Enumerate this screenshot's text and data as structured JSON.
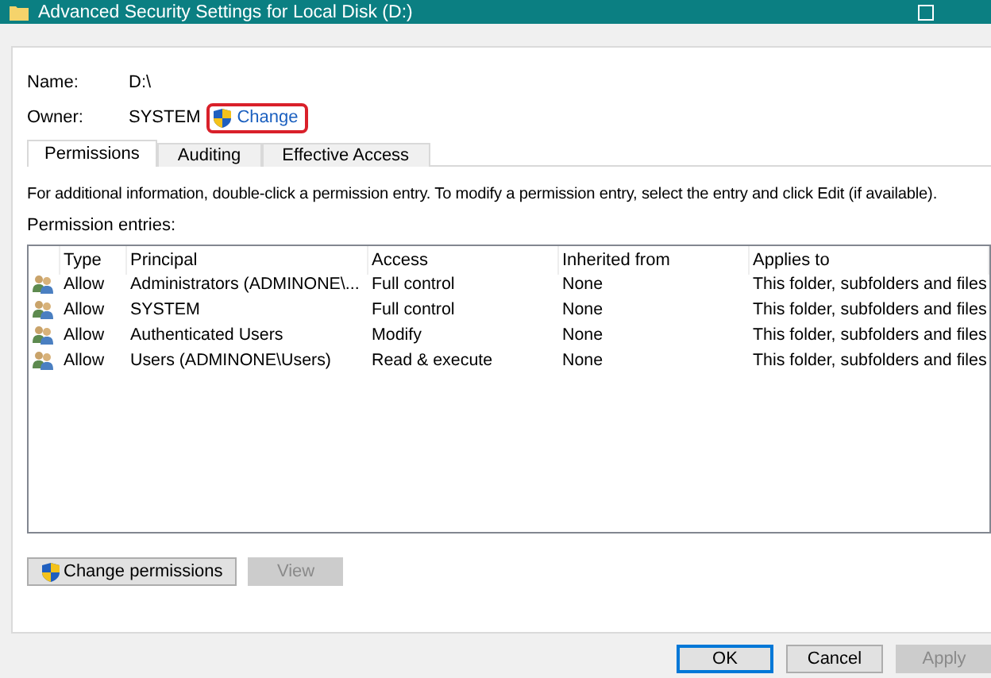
{
  "window": {
    "title": "Advanced Security Settings for Local Disk (D:)"
  },
  "name": {
    "label": "Name:",
    "value": "D:\\"
  },
  "owner": {
    "label": "Owner:",
    "value": "SYSTEM",
    "link": "Change"
  },
  "tabs": [
    {
      "label": "Permissions",
      "selected": true
    },
    {
      "label": "Auditing",
      "selected": false
    },
    {
      "label": "Effective Access",
      "selected": false
    }
  ],
  "info": "For additional information, double-click a permission entry. To modify a permission entry, select the entry and click Edit (if available).",
  "entries_label": "Permission entries:",
  "table": {
    "columns": [
      "Type",
      "Principal",
      "Access",
      "Inherited from",
      "Applies to"
    ],
    "rows": [
      [
        "Allow",
        "Administrators (ADMINONE\\...",
        "Full control",
        "None",
        "This folder, subfolders and files"
      ],
      [
        "Allow",
        "SYSTEM",
        "Full control",
        "None",
        "This folder, subfolders and files"
      ],
      [
        "Allow",
        "Authenticated Users",
        "Modify",
        "None",
        "This folder, subfolders and files"
      ],
      [
        "Allow",
        "Users (ADMINONE\\Users)",
        "Read & execute",
        "None",
        "This folder, subfolders and files"
      ]
    ]
  },
  "actions": [
    {
      "label": "Change permissions",
      "shield": true,
      "disabled": false
    },
    {
      "label": "View",
      "shield": false,
      "disabled": true
    }
  ],
  "dialog_buttons": [
    {
      "label": "OK",
      "default": true,
      "disabled": false
    },
    {
      "label": "Cancel",
      "default": false,
      "disabled": false
    },
    {
      "label": "Apply",
      "default": false,
      "disabled": true
    }
  ]
}
